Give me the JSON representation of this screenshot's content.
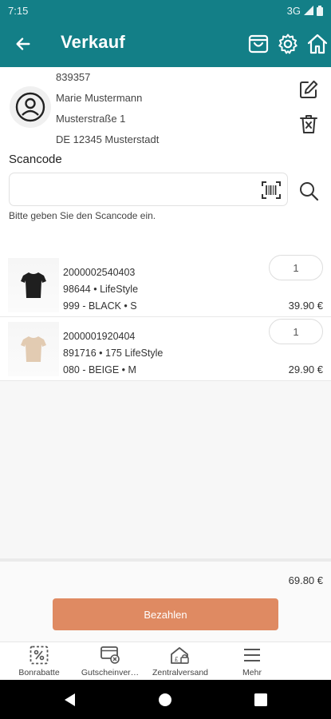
{
  "status_bar": {
    "time": "7:15",
    "network": "3G"
  },
  "app_bar": {
    "title": "Verkauf",
    "back_icon": "arrow-left-icon",
    "icons": [
      "shopping-bag-icon",
      "gear-icon",
      "home-icon"
    ]
  },
  "customer": {
    "number": "839357",
    "name": "Marie Mustermann",
    "street": "Musterstraße 1",
    "city": "DE 12345 Musterstadt",
    "avatar_icon": "user-icon",
    "actions": [
      "edit-icon",
      "trash-icon"
    ]
  },
  "scan": {
    "label": "Scancode",
    "value": "",
    "placeholder": "",
    "hint": "Bitte geben Sie den Scancode ein.",
    "barcode_icon": "barcode-scan-icon",
    "search_icon": "search-icon"
  },
  "items": [
    {
      "ean": "2000002540403",
      "article": "98644 • LifeStyle",
      "variant": "999 - BLACK • S",
      "quantity": "1",
      "price": "39.90 €",
      "thumb_color": "#1f1f1f"
    },
    {
      "ean": "2000001920404",
      "article": "891716 • 175 LifeStyle",
      "variant": "080 - BEIGE • M",
      "quantity": "1",
      "price": "29.90 €",
      "thumb_color": "#e2cbb2"
    }
  ],
  "total": "69.80 €",
  "pay_button": "Bezahlen",
  "bottom_nav": [
    {
      "label": "Bonrabatte",
      "icon": "percent-discount-icon"
    },
    {
      "label": "Gutscheinver…",
      "icon": "voucher-icon"
    },
    {
      "label": "Zentralversand",
      "icon": "warehouse-icon"
    },
    {
      "label": "Mehr",
      "icon": "menu-icon"
    }
  ],
  "colors": {
    "primary": "#137f87",
    "accent": "#df8a62"
  }
}
